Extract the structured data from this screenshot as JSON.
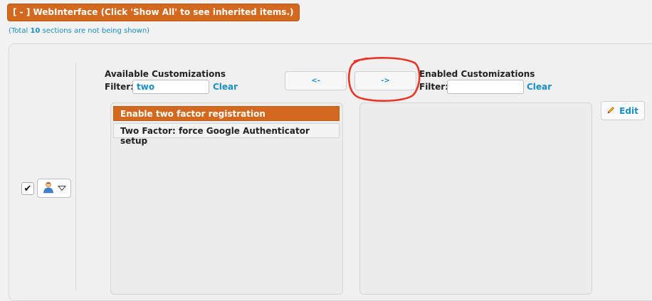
{
  "section": {
    "header": "[ - ] WebInterface (Click 'Show All' to see inherited items.)",
    "hidden_note_prefix": "(Total ",
    "hidden_count": "10",
    "hidden_note_suffix": " sections are not being shown)"
  },
  "row": {
    "checkbox_mark": "✔",
    "checked": true
  },
  "available": {
    "title": "Available Customizations",
    "filter_label": "Filter:",
    "filter_value": "two",
    "clear_label": "Clear",
    "items": [
      {
        "label": "Enable two factor registration",
        "selected": true
      },
      {
        "label": "Two Factor: force Google Authenticator setup",
        "selected": false
      }
    ]
  },
  "enabled": {
    "title": "Enabled Customizations",
    "filter_label": "Filter:",
    "filter_value": "",
    "clear_label": "Clear",
    "items": []
  },
  "buttons": {
    "move_left": "<-",
    "move_right": "->",
    "edit": "Edit"
  },
  "colors": {
    "accent_orange": "#d2691e",
    "link_blue": "#1a8fc2",
    "annotation_red": "#e8352a"
  },
  "icons": {
    "user": "user-icon",
    "dropdown": "chevron-down-icon",
    "edit": "pencil-icon"
  }
}
